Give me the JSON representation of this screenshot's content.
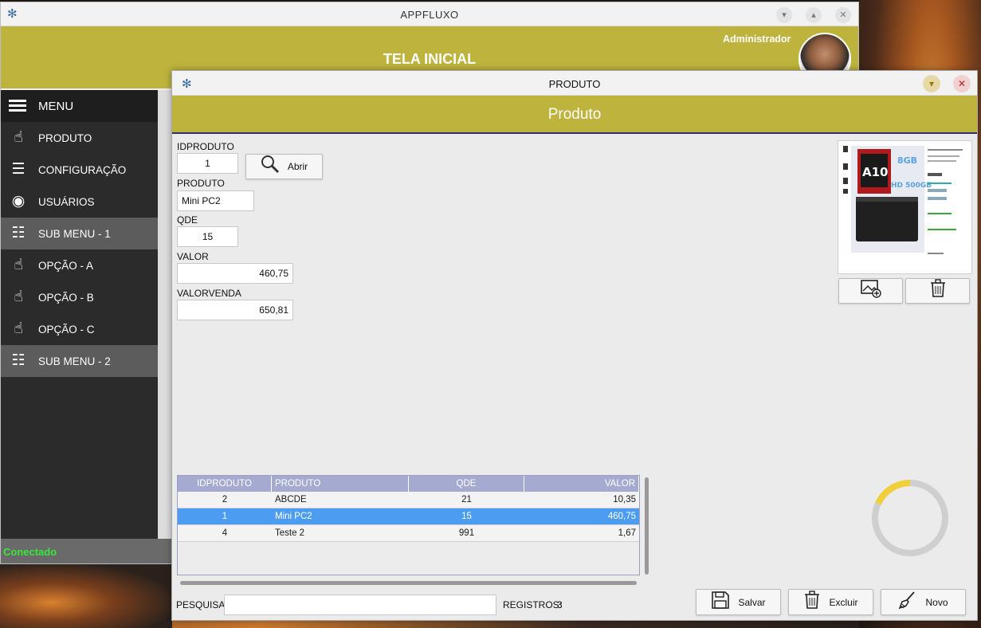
{
  "main_window": {
    "title": "APPFLUXO",
    "header_title": "TELA INICIAL",
    "user_name": "Administrador",
    "status": "Conectado"
  },
  "sidebar": {
    "menu_label": "MENU",
    "items": [
      {
        "label": "PRODUTO",
        "icon": "hand-coin-icon",
        "sub": false
      },
      {
        "label": "CONFIGURAÇÃO",
        "icon": "sliders-icon",
        "sub": false
      },
      {
        "label": "USUÁRIOS",
        "icon": "user-circle-icon",
        "sub": false
      },
      {
        "label": "SUB MENU - 1",
        "icon": "list-icon",
        "sub": true
      },
      {
        "label": "OPÇÃO - A",
        "icon": "hand-coin-icon",
        "sub": false
      },
      {
        "label": "OPÇÃO - B",
        "icon": "hand-coin-icon",
        "sub": false
      },
      {
        "label": "OPÇÃO - C",
        "icon": "hand-coin-icon",
        "sub": false
      },
      {
        "label": "SUB MENU - 2",
        "icon": "list-icon",
        "sub": true
      }
    ]
  },
  "produto_window": {
    "title": "PRODUTO",
    "header": "Produto",
    "form": {
      "idproduto_label": "IDPRODUTO",
      "idproduto_value": "1",
      "abrir_label": "Abrir",
      "produto_label": "PRODUTO",
      "produto_value": "Mini PC2",
      "qde_label": "QDE",
      "qde_value": "15",
      "valor_label": "VALOR",
      "valor_value": "460,75",
      "valorvenda_label": "VALORVENDA",
      "valorvenda_value": "650,81"
    },
    "table": {
      "columns": [
        "IDPRODUTO",
        "PRODUTO",
        "QDE",
        "VALOR"
      ],
      "rows": [
        [
          "2",
          "ABCDE",
          "21",
          "10,35"
        ],
        [
          "1",
          "Mini PC2",
          "15",
          "460,75"
        ],
        [
          "4",
          "Teste 2",
          "991",
          "1,67"
        ]
      ],
      "selected_row": 1
    },
    "search_label": "PESQUISA:",
    "search_value": "",
    "registros_label": "REGISTROS:",
    "registros_value": "3",
    "buttons": {
      "salvar": "Salvar",
      "excluir": "Excluir",
      "novo": "Novo"
    }
  }
}
